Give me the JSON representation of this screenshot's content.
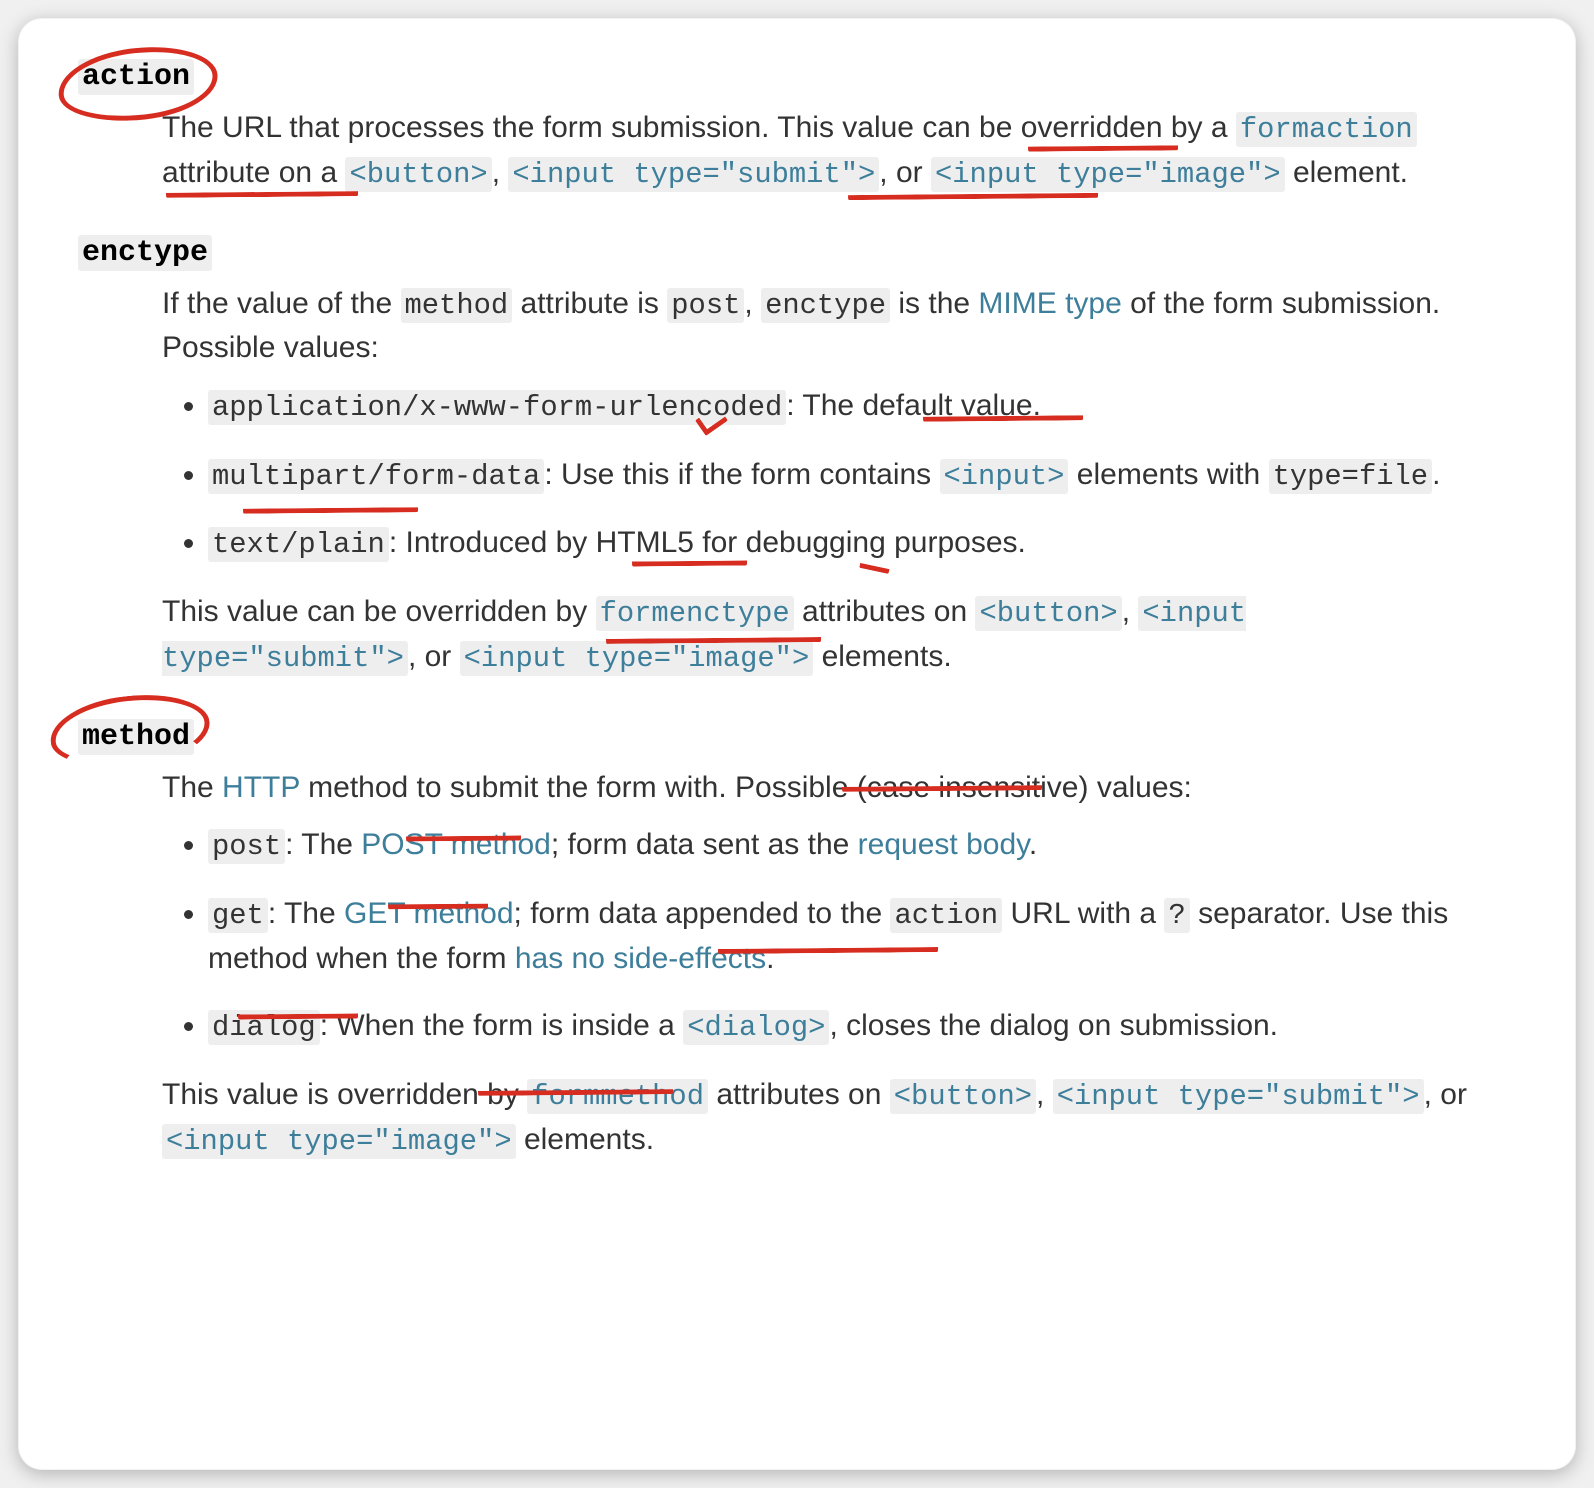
{
  "terms": {
    "action": {
      "name": "action",
      "desc_pre": "The URL that processes the form submission. This value can be ",
      "overridden": "overridden",
      "desc_mid": " by a ",
      "formaction": "formaction",
      "desc_mid2": " attribute on a ",
      "button": "<button>",
      "comma": ", ",
      "input_submit": "<input type=\"submit\">",
      "or": ", or ",
      "input_image": "<input type=\"image\">",
      "desc_end": " element."
    },
    "enctype": {
      "name": "enctype",
      "intro_pre": "If the value of the ",
      "method_code": "method",
      "intro_mid1": " attribute is ",
      "post_code": "post",
      "intro_mid2": ", ",
      "enctype_code": "enctype",
      "intro_mid3": " is the ",
      "mime_link": "MIME type",
      "intro_end": " of the form submission. Possible values:",
      "li1_code": "application/x-www-form-urlencoded",
      "li1_text": ": The default value.",
      "li2_code": "multipart/form-data",
      "li2_text_pre": ": Use this if the form contains ",
      "li2_input": "<input>",
      "li2_text_mid": " elements with ",
      "li2_typefile": "type=file",
      "li2_text_end": ".",
      "li3_code": "text/plain",
      "li3_text": ": Introduced by HTML5 for debugging purposes.",
      "override_pre": "This value can be overridden by ",
      "formenctype": "formenctype",
      "override_mid": " attributes on ",
      "button": "<button>",
      "comma": ", ",
      "input_submit": "<input type=\"submit\">",
      "or": ", or ",
      "input_image": "<input type=\"image\">",
      "override_end": " elements."
    },
    "method": {
      "name": "method",
      "intro_pre": "The ",
      "http_link": "HTTP",
      "intro_mid": " method to submit the form with. Possible (case insensitive) values:",
      "li1_code": "post",
      "li1_pre": ": The ",
      "li1_post_link": "POST method",
      "li1_mid": "; form data sent as the ",
      "li1_body_link": "request body",
      "li1_end": ".",
      "li2_code": "get",
      "li2_pre": ": The ",
      "li2_get_link": "GET method",
      "li2_mid": "; form data appended to the ",
      "li2_action": "action",
      "li2_mid2": " URL with a ",
      "li2_qmark": "?",
      "li2_mid3": " separator. Use this method when the form ",
      "li2_noside_link": "has no side-effects",
      "li2_end": ".",
      "li3_code": "dialog",
      "li3_pre": ": When the form is inside a ",
      "li3_dialog": "<dialog>",
      "li3_end": ", closes the dialog on submission.",
      "override_pre": "This value is overridden by ",
      "formmethod": "formmethod",
      "override_mid": " attributes on ",
      "button": "<button>",
      "comma": ", ",
      "input_submit": "<input type=\"submit\">",
      "or": ", or ",
      "input_image": "<input type=\"image\">",
      "override_end": "  elements."
    }
  }
}
